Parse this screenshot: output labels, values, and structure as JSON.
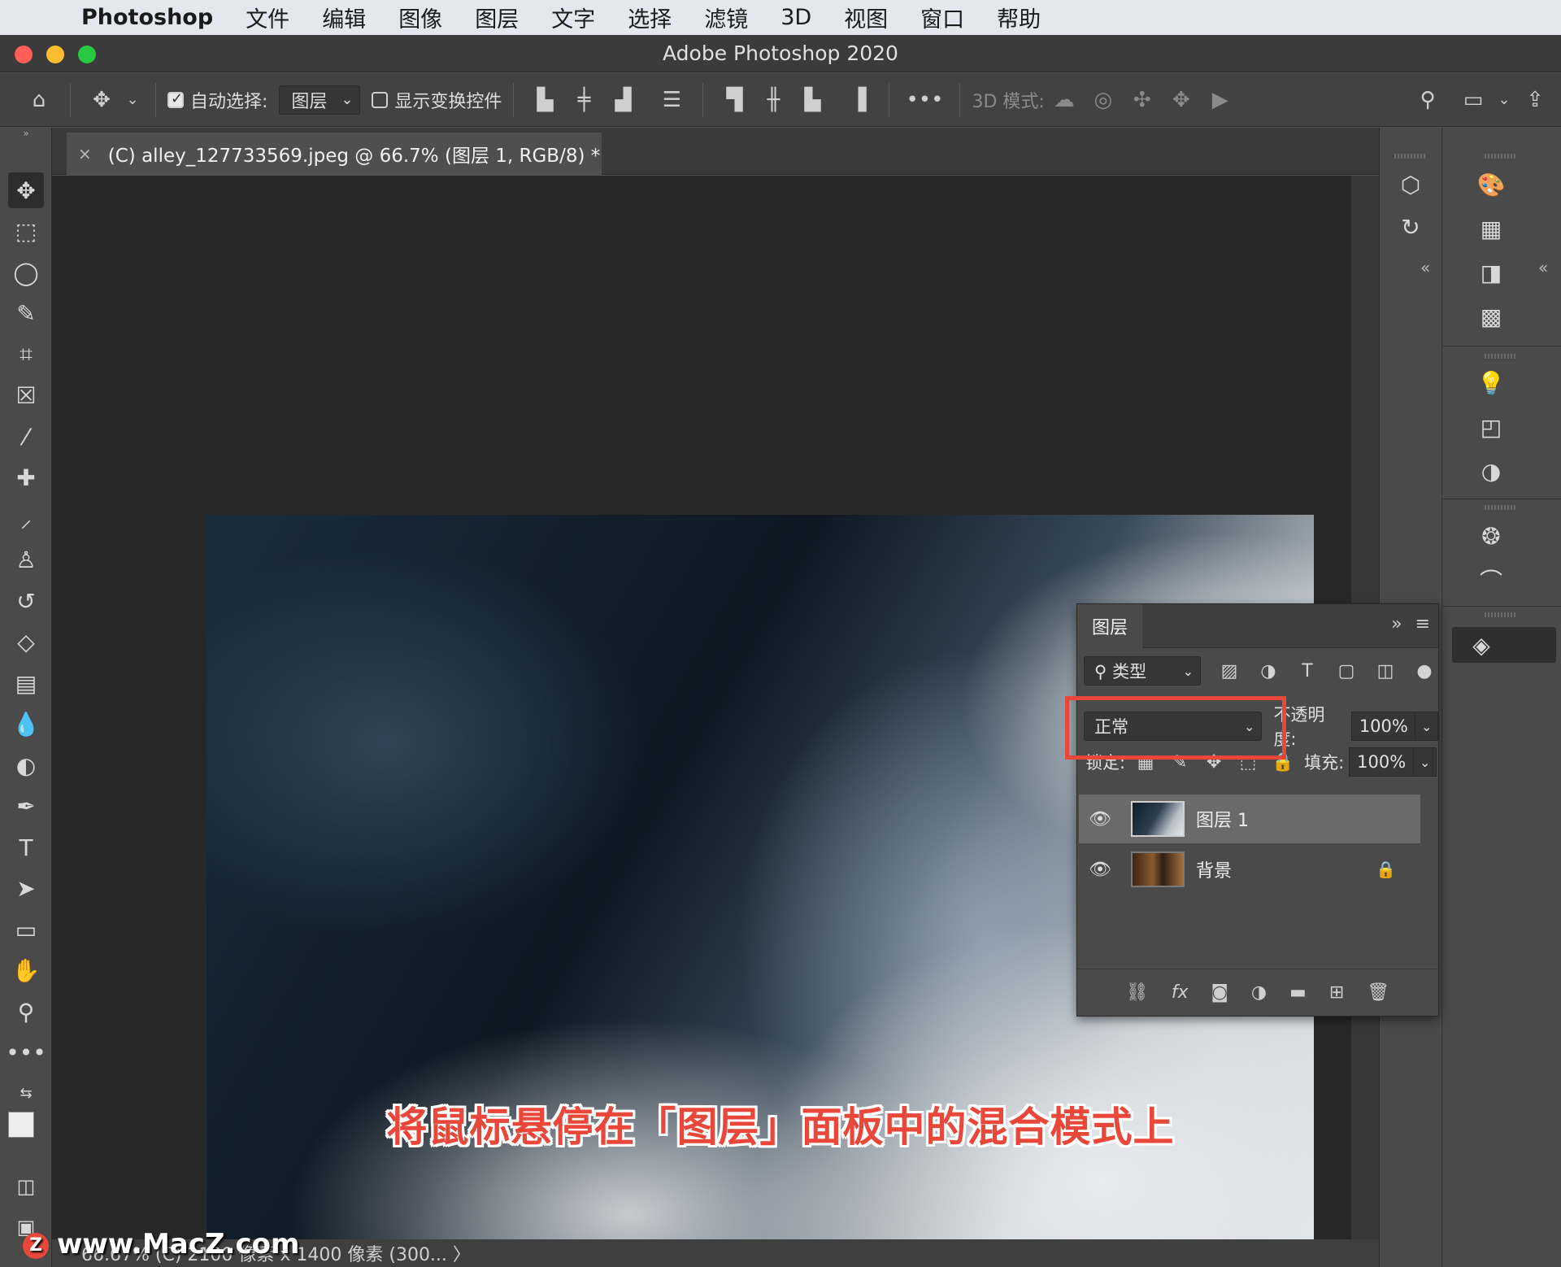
{
  "menubar": {
    "apple": "",
    "app": "Photoshop",
    "items": [
      "文件",
      "编辑",
      "图像",
      "图层",
      "文字",
      "选择",
      "滤镜",
      "3D",
      "视图",
      "窗口",
      "帮助"
    ]
  },
  "window": {
    "title": "Adobe Photoshop 2020"
  },
  "options": {
    "auto_select_label": "自动选择:",
    "auto_select_checked": true,
    "auto_select_target": "图层",
    "show_transform_label": "显示变换控件",
    "mode_3d_label": "3D 模式:",
    "more": "•••"
  },
  "document": {
    "tab_title": "(C) alley_127733569.jpeg @ 66.7% (图层 1, RGB/8) *",
    "close": "×"
  },
  "caption": "将鼠标悬停在「图层」面板中的混合模式上",
  "status": {
    "text": "66.67%    (C) 2100 像素 x 1400 像素 (300... 〉"
  },
  "watermark": {
    "logo": "Z",
    "text": "www.MacZ.com"
  },
  "layers_panel": {
    "tab": "图层",
    "filter_label": "类型",
    "blend_mode": "正常",
    "opacity_label": "不透明度:",
    "opacity_value": "100%",
    "lock_label": "锁定:",
    "fill_label": "填充:",
    "fill_value": "100%",
    "layers": [
      {
        "name": "图层 1",
        "selected": true,
        "visible": true,
        "locked": false
      },
      {
        "name": "背景",
        "selected": false,
        "visible": true,
        "locked": true
      }
    ]
  },
  "colors": {
    "highlight": "#e8473a",
    "panel_bg": "#4a4a4a",
    "canvas_bg": "#282828"
  }
}
